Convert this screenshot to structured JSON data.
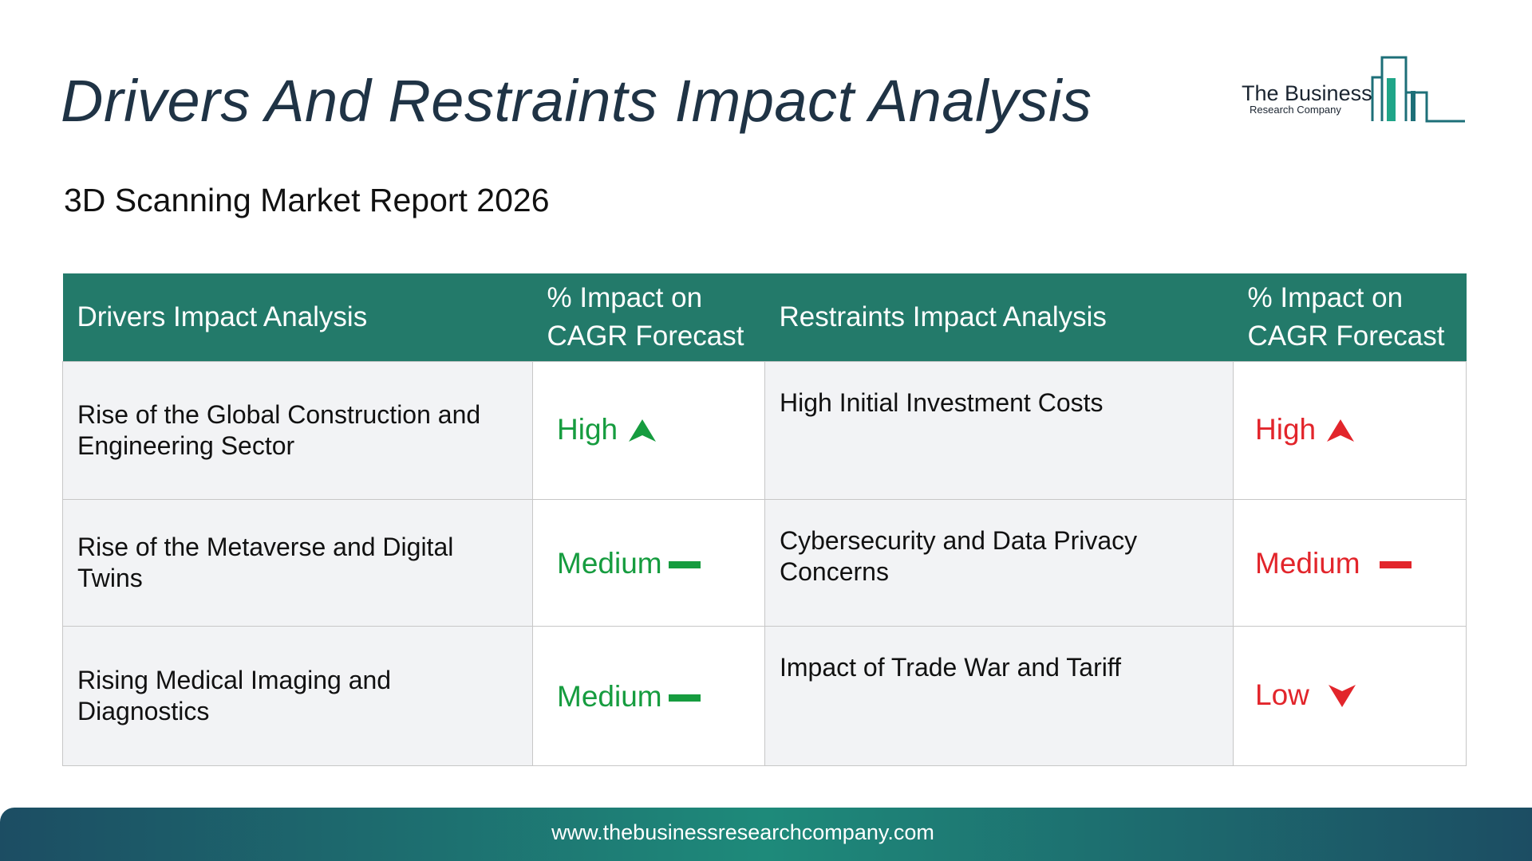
{
  "page": {
    "title": "Drivers And Restraints Impact Analysis",
    "subtitle": "3D Scanning Market Report 2026"
  },
  "logo": {
    "main": "The Business",
    "sub": "Research Company"
  },
  "table": {
    "headers": {
      "drivers": "Drivers Impact Analysis",
      "drivers_impact": "% Impact on CAGR Forecast",
      "restraints": "Restraints Impact Analysis",
      "restraints_impact": "% Impact on CAGR Forecast"
    },
    "rows": [
      {
        "driver": "Rise of the Global Construction and Engineering Sector",
        "driver_impact": "High",
        "driver_impact_icon": "arrow-up-icon",
        "restraint": "High Initial Investment Costs",
        "restraint_impact": "High",
        "restraint_impact_icon": "arrow-up-icon"
      },
      {
        "driver": "Rise of the Metaverse and Digital Twins",
        "driver_impact": "Medium",
        "driver_impact_icon": "dash-icon",
        "restraint": "Cybersecurity and Data Privacy Concerns",
        "restraint_impact": "Medium",
        "restraint_impact_icon": "dash-icon"
      },
      {
        "driver": "Rising Medical Imaging and Diagnostics",
        "driver_impact": "Medium",
        "driver_impact_icon": "dash-icon",
        "restraint": "Impact of Trade War and Tariff",
        "restraint_impact": "Low",
        "restraint_impact_icon": "arrow-down-icon"
      }
    ]
  },
  "colors": {
    "header_bg": "#237a6a",
    "driver_impact": "#169c3f",
    "restraint_impact": "#e2252b",
    "title": "#1f3345"
  },
  "footer": {
    "url": "www.thebusinessresearchcompany.com"
  }
}
